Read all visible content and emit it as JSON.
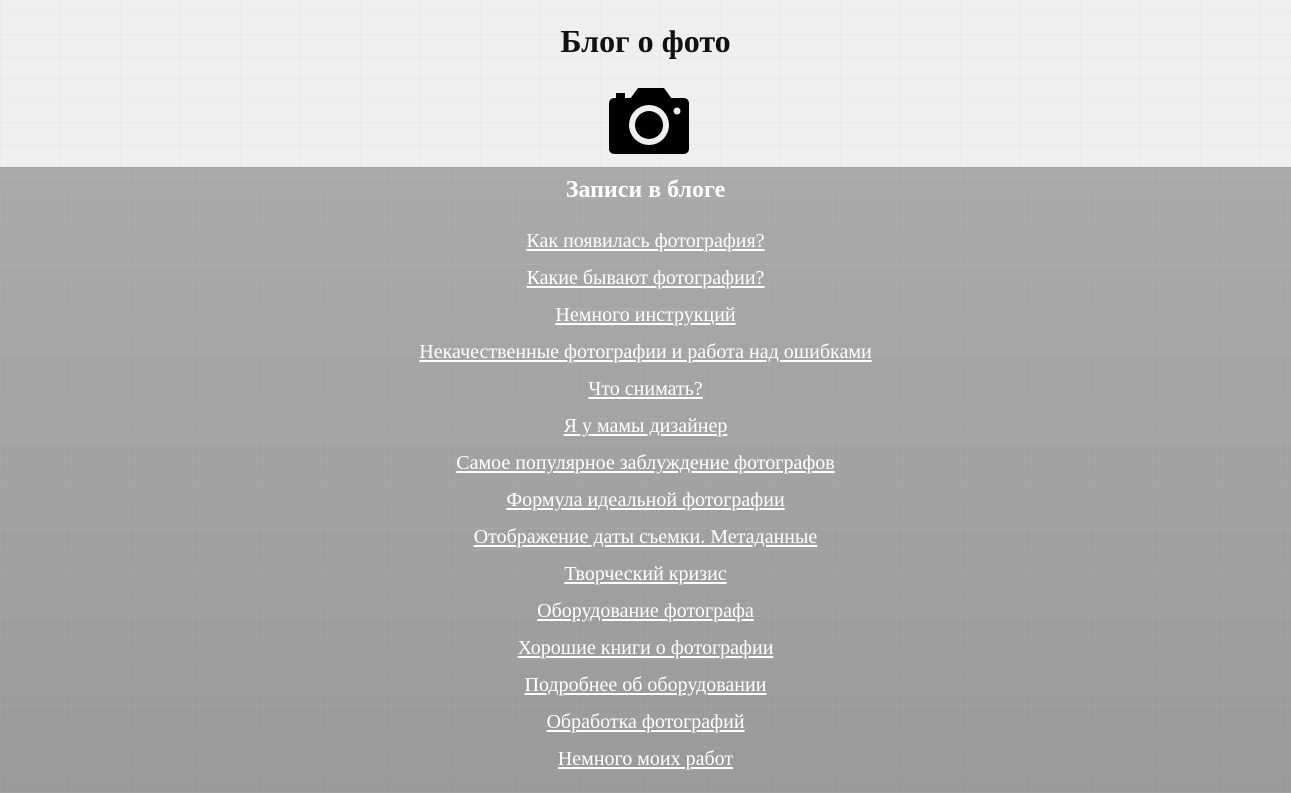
{
  "header": {
    "title": "Блог о фото",
    "logo_icon": "camera-icon"
  },
  "blog": {
    "heading": "Записи в блоге",
    "posts": [
      "Как появилась фотография?",
      "Какие бывают фотографии?",
      "Немного инструкций",
      "Некачественные фотографии и работа над ошибками",
      "Что снимать?",
      "Я у мамы дизайнер",
      "Самое популярное заблуждение фотографов",
      "Формула идеальной фотографии",
      "Отображение даты съемки. Метаданные",
      "Творческий кризис",
      "Оборудование фотографа",
      "Хорошие книги о фотографии",
      "Подробнее об оборудовании",
      "Обработка фотографий",
      "Немного моих работ"
    ]
  },
  "colors": {
    "header_bg": "#efefef",
    "main_bg": "#a3a4a6",
    "title_text": "#111111",
    "link_text": "#ffffff"
  }
}
